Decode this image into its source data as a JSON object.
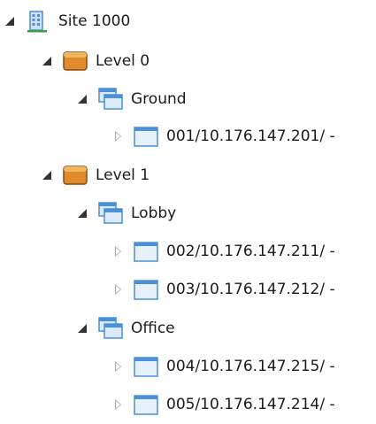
{
  "tree": {
    "site": {
      "label": "Site 1000",
      "icon": "building-icon",
      "expanded": true,
      "levels": [
        {
          "label": "Level 0",
          "icon": "level-icon",
          "expanded": true,
          "groups": [
            {
              "label": "Ground",
              "icon": "window-group-icon",
              "expanded": true,
              "devices": [
                {
                  "label": "001/10.176.147.201/ -",
                  "icon": "device-icon",
                  "expanded": false
                }
              ]
            }
          ]
        },
        {
          "label": "Level 1",
          "icon": "level-icon",
          "expanded": true,
          "groups": [
            {
              "label": "Lobby",
              "icon": "window-group-icon",
              "expanded": true,
              "devices": [
                {
                  "label": "002/10.176.147.211/ -",
                  "icon": "device-icon",
                  "expanded": false
                },
                {
                  "label": "003/10.176.147.212/ -",
                  "icon": "device-icon",
                  "expanded": false
                }
              ]
            },
            {
              "label": "Office",
              "icon": "window-group-icon",
              "expanded": true,
              "devices": [
                {
                  "label": "004/10.176.147.215/ -",
                  "icon": "device-icon",
                  "expanded": false
                },
                {
                  "label": "005/10.176.147.214/ -",
                  "icon": "device-icon",
                  "expanded": false
                }
              ]
            }
          ]
        }
      ]
    }
  },
  "colors": {
    "text": "#1a1a1a",
    "expander_expanded": "#333333",
    "expander_collapsed": "#a6a6a6",
    "level_icon": "#e08a2c",
    "window_icon_border": "#4a90d9",
    "window_icon_fill": "#dcebfa",
    "building_icon": "#4a8fd0"
  }
}
